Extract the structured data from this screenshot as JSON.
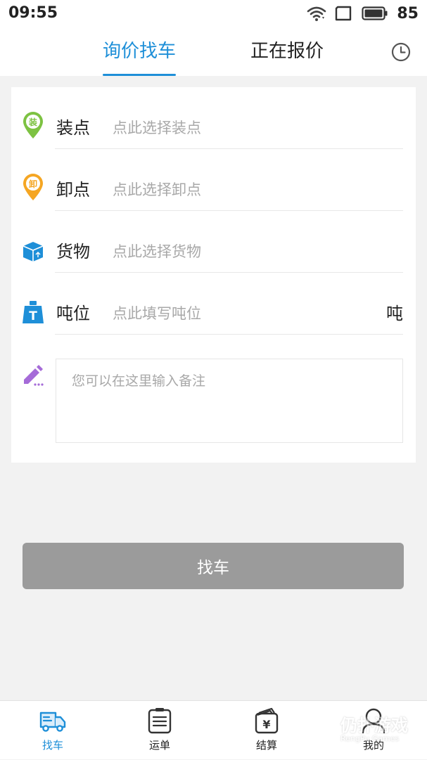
{
  "status_bar": {
    "time": "09:55",
    "battery": "85"
  },
  "tabs": {
    "inquiry": "询价找车",
    "quoting": "正在报价"
  },
  "form": {
    "rows": [
      {
        "label": "装点",
        "value": "点此选择装点",
        "icon": "loading-point-pin-icon",
        "icon_text": "装",
        "color": "#7dc242"
      },
      {
        "label": "卸点",
        "value": "点此选择卸点",
        "icon": "unloading-point-pin-icon",
        "icon_text": "卸",
        "color": "#f5a623"
      },
      {
        "label": "货物",
        "value": "点此选择货物",
        "icon": "cargo-box-icon",
        "color": "#1e8fd8"
      },
      {
        "label": "吨位",
        "value": "点此填写吨位",
        "unit": "吨",
        "icon": "weight-icon",
        "icon_text": "T",
        "color": "#1e8fd8"
      }
    ],
    "notes_placeholder": "您可以在这里输入备注",
    "notes_icon": "edit-pencil-icon",
    "notes_icon_color": "#a56bd8"
  },
  "find_car_button": "找车",
  "bottom_nav": [
    {
      "label": "找车",
      "icon": "truck-icon",
      "active": true
    },
    {
      "label": "运单",
      "icon": "waybill-clipboard-icon",
      "active": false
    },
    {
      "label": "结算",
      "icon": "settlement-wallet-icon",
      "active": false
    },
    {
      "label": "我的",
      "icon": "user-profile-icon",
      "active": false
    }
  ],
  "watermark": {
    "text": "仍扑游戏",
    "sub": "RengPu Games"
  },
  "colors": {
    "accent": "#1e8fd8",
    "button_disabled": "#9b9b9b",
    "background": "#f2f2f2"
  }
}
